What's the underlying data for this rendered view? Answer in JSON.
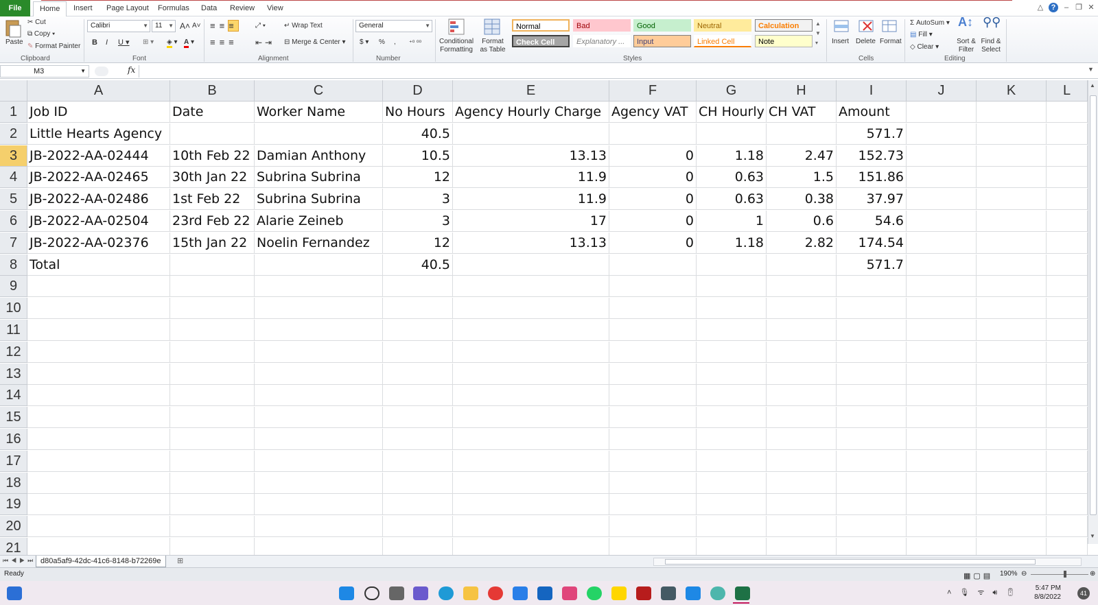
{
  "tabs": [
    "File",
    "Home",
    "Insert",
    "Page Layout",
    "Formulas",
    "Data",
    "Review",
    "View"
  ],
  "ribbon": {
    "clipboard": {
      "label": "Clipboard",
      "paste": "Paste",
      "cut": "Cut",
      "copy": "Copy",
      "format_painter": "Format Painter"
    },
    "font": {
      "label": "Font",
      "family": "Calibri",
      "size": "11"
    },
    "alignment": {
      "label": "Alignment",
      "wrap_text": "Wrap Text",
      "merge_center": "Merge & Center"
    },
    "number": {
      "label": "Number",
      "format": "General"
    },
    "styles": {
      "label": "Styles",
      "conditional_formatting": "Conditional Formatting",
      "format_as_table": "Format as Table",
      "items": [
        {
          "name": "Normal",
          "bg": "#ffffff",
          "fg": "#000000",
          "border": "#f0b25a"
        },
        {
          "name": "Bad",
          "bg": "#ffc7ce",
          "fg": "#9c0006",
          "border": "#ffc7ce"
        },
        {
          "name": "Good",
          "bg": "#c6efce",
          "fg": "#006100",
          "border": "#c6efce"
        },
        {
          "name": "Neutral",
          "bg": "#ffeb9c",
          "fg": "#9c6500",
          "border": "#ffeb9c"
        },
        {
          "name": "Calculation",
          "bg": "#f2f2f2",
          "fg": "#fa7d00",
          "border": "#7f7f7f"
        },
        {
          "name": "Check Cell",
          "bg": "#a5a5a5",
          "fg": "#ffffff",
          "border": "#3f3f3f"
        },
        {
          "name": "Explanatory ...",
          "bg": "#ffffff",
          "fg": "#7f7f7f",
          "border": "#ffffff"
        },
        {
          "name": "Input",
          "bg": "#ffcc99",
          "fg": "#3f3f76",
          "border": "#7f7f7f"
        },
        {
          "name": "Linked Cell",
          "bg": "#ffffff",
          "fg": "#fa7d00",
          "border": "#ffffff"
        },
        {
          "name": "Note",
          "bg": "#ffffcc",
          "fg": "#000000",
          "border": "#b2b2b2"
        }
      ]
    },
    "cells": {
      "label": "Cells",
      "insert": "Insert",
      "delete": "Delete",
      "format": "Format"
    },
    "editing": {
      "label": "Editing",
      "autosum": "AutoSum",
      "fill": "Fill",
      "clear": "Clear",
      "sort_filter": "Sort & Filter",
      "find_select": "Find & Select"
    }
  },
  "name_box": "M3",
  "fx": "fx",
  "columns": [
    "A",
    "B",
    "C",
    "D",
    "E",
    "F",
    "G",
    "H",
    "I",
    "J",
    "K",
    "L"
  ],
  "rows": [
    [
      "Job ID",
      "Date",
      "Worker Name",
      "No Hours",
      "Agency Hourly Charge",
      "Agency VAT",
      "CH Hourly",
      "CH VAT",
      "Amount",
      "",
      "",
      ""
    ],
    [
      "Little Hearts Agency",
      "",
      "",
      "40.5",
      "",
      "",
      "",
      "",
      "571.7",
      "",
      "",
      ""
    ],
    [
      "JB-2022-AA-02444",
      "10th Feb 22",
      "Damian  Anthony",
      "10.5",
      "13.13",
      "0",
      "1.18",
      "2.47",
      "152.73",
      "",
      "",
      ""
    ],
    [
      "JB-2022-AA-02465",
      "30th Jan 22",
      "Subrina Subrina",
      "12",
      "11.9",
      "0",
      "0.63",
      "1.5",
      "151.86",
      "",
      "",
      ""
    ],
    [
      "JB-2022-AA-02486",
      "1st Feb 22",
      "Subrina Subrina",
      "3",
      "11.9",
      "0",
      "0.63",
      "0.38",
      "37.97",
      "",
      "",
      ""
    ],
    [
      "JB-2022-AA-02504",
      "23rd Feb 22",
      "Alarie Zeineb",
      "3",
      "17",
      "0",
      "1",
      "0.6",
      "54.6",
      "",
      "",
      ""
    ],
    [
      "JB-2022-AA-02376",
      "15th Jan 22",
      "Noelin Fernandez",
      "12",
      "13.13",
      "0",
      "1.18",
      "2.82",
      "174.54",
      "",
      "",
      ""
    ],
    [
      "Total",
      "",
      "",
      "40.5",
      "",
      "",
      "",
      "",
      "571.7",
      "",
      "",
      ""
    ],
    [
      "",
      "",
      "",
      "",
      "",
      "",
      "",
      "",
      "",
      "",
      "",
      ""
    ],
    [
      "",
      "",
      "",
      "",
      "",
      "",
      "",
      "",
      "",
      "",
      "",
      ""
    ],
    [
      "",
      "",
      "",
      "",
      "",
      "",
      "",
      "",
      "",
      "",
      "",
      ""
    ],
    [
      "",
      "",
      "",
      "",
      "",
      "",
      "",
      "",
      "",
      "",
      "",
      ""
    ],
    [
      "",
      "",
      "",
      "",
      "",
      "",
      "",
      "",
      "",
      "",
      "",
      ""
    ],
    [
      "",
      "",
      "",
      "",
      "",
      "",
      "",
      "",
      "",
      "",
      "",
      ""
    ],
    [
      "",
      "",
      "",
      "",
      "",
      "",
      "",
      "",
      "",
      "",
      "",
      ""
    ],
    [
      "",
      "",
      "",
      "",
      "",
      "",
      "",
      "",
      "",
      "",
      "",
      ""
    ],
    [
      "",
      "",
      "",
      "",
      "",
      "",
      "",
      "",
      "",
      "",
      "",
      ""
    ],
    [
      "",
      "",
      "",
      "",
      "",
      "",
      "",
      "",
      "",
      "",
      "",
      ""
    ],
    [
      "",
      "",
      "",
      "",
      "",
      "",
      "",
      "",
      "",
      "",
      "",
      ""
    ],
    [
      "",
      "",
      "",
      "",
      "",
      "",
      "",
      "",
      "",
      "",
      "",
      ""
    ],
    [
      "",
      "",
      "",
      "",
      "",
      "",
      "",
      "",
      "",
      "",
      "",
      ""
    ]
  ],
  "selected_row": 3,
  "sheet_tab": "d80a5af9-42dc-41c6-8148-b72269e",
  "status": {
    "ready": "Ready",
    "zoom": "190%"
  },
  "taskbar": {
    "time": "5:47 PM",
    "date": "8/8/2022",
    "badge": "41"
  }
}
